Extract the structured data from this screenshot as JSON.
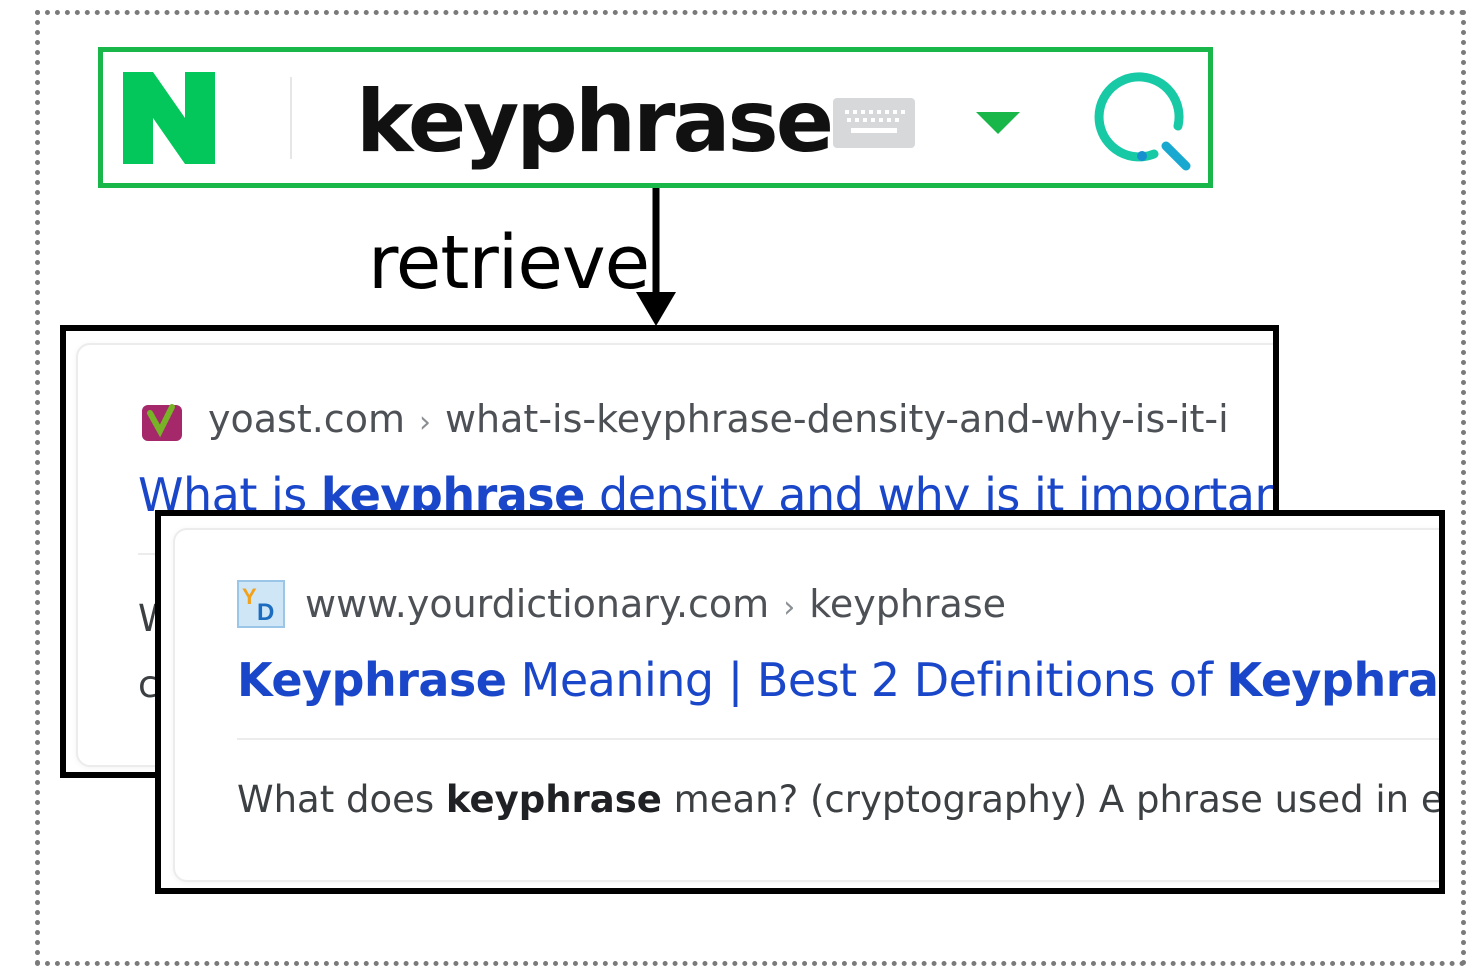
{
  "search": {
    "query": "keyphrase",
    "colors": {
      "border": "#19b74a",
      "logo": "#03c75a",
      "lens": "#18c9a6",
      "caret": "#19b74a"
    },
    "icons": [
      "naver-logo-icon",
      "keyboard-icon",
      "dropdown-caret-icon",
      "search-lens-icon"
    ]
  },
  "arrow": {
    "label": "retrieve"
  },
  "results": [
    {
      "favicon": "yoast-favicon",
      "domain": "yoast.com",
      "separator": "›",
      "path": "what-is-keyphrase-density-and-why-is-it-i",
      "title_pre": "What is ",
      "title_bold": "keyphrase",
      "title_post": " density and why is it important?",
      "snippet_1": "W",
      "snippet_2": "c"
    },
    {
      "favicon": "yourdictionary-favicon",
      "domain": "www.yourdictionary.com",
      "separator": "›",
      "path": "keyphrase",
      "title_bold_1": "Keyphrase",
      "title_mid": " Meaning | Best 2 Definitions of ",
      "title_bold_2": "Keyphrase",
      "snippet_pre": "What does ",
      "snippet_bold": "keyphrase",
      "snippet_post": " mean? (cryptography) A phrase used in enc"
    }
  ]
}
